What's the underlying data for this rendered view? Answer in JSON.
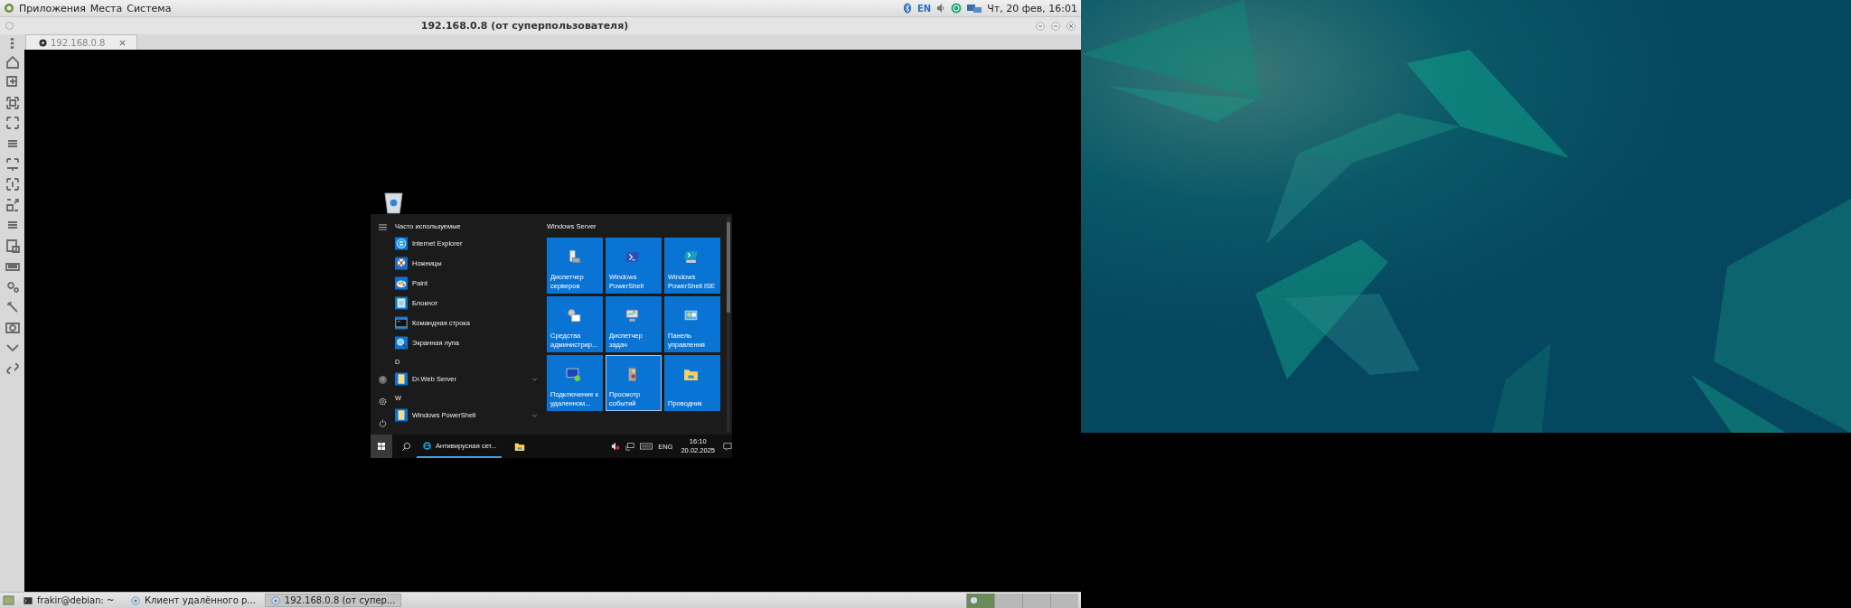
{
  "top_panel": {
    "menus": [
      "Приложения",
      "Места",
      "Система"
    ],
    "keyboard_layout": "EN",
    "clock": "Чт, 20 фев, 16:01"
  },
  "window": {
    "title": "192.168.0.8 (от суперпользователя)"
  },
  "tabs": [
    {
      "label": "192.168.0.8",
      "selected": true
    }
  ],
  "remote": {
    "start_menu": {
      "frequent_heading": "Часто используемые",
      "frequent": [
        {
          "label": "Internet Explorer",
          "kind": "ie"
        },
        {
          "label": "Ножницы",
          "kind": "scissors"
        },
        {
          "label": "Paint",
          "kind": "paint"
        },
        {
          "label": "Блокнот",
          "kind": "notepad"
        },
        {
          "label": "Командная строка",
          "kind": "cmd"
        },
        {
          "label": "Экранная лупа",
          "kind": "magnifier"
        }
      ],
      "groups": [
        {
          "letter": "D",
          "apps": [
            {
              "label": "Dr.Web Server",
              "kind": "folder",
              "expandable": true
            }
          ]
        },
        {
          "letter": "W",
          "apps": [
            {
              "label": "Windows PowerShell",
              "kind": "folder",
              "expandable": true
            }
          ]
        }
      ],
      "tiles_heading": "Windows Server",
      "tiles": [
        {
          "label": "Диспетчер серверов",
          "kind": "server",
          "selected": false
        },
        {
          "label": "Windows PowerShell",
          "kind": "powershell",
          "selected": false
        },
        {
          "label": "Windows PowerShell ISE",
          "kind": "ise",
          "selected": false
        },
        {
          "label": "Средства администрир...",
          "kind": "admin",
          "selected": false
        },
        {
          "label": "Диспетчер задач",
          "kind": "taskmgr",
          "selected": false
        },
        {
          "label": "Панель управления",
          "kind": "control",
          "selected": false
        },
        {
          "label": "Подключение к удаленном...",
          "kind": "rdp",
          "selected": false
        },
        {
          "label": "Просмотр событий",
          "kind": "events",
          "selected": true
        },
        {
          "label": "Проводник",
          "kind": "explorer",
          "selected": false
        }
      ]
    },
    "taskbar": {
      "app": "Антивирусная сет...",
      "language": "ENG",
      "time": "16:10",
      "date": "20.02.2025"
    }
  },
  "bottom_panel": {
    "tasks": [
      {
        "label": "frakir@debian: ~",
        "kind": "terminal",
        "selected": false
      },
      {
        "label": "Клиент удалённого р...",
        "kind": "remote",
        "selected": false
      },
      {
        "label": "192.168.0.8 (от супер...",
        "kind": "remote",
        "selected": true
      }
    ]
  }
}
